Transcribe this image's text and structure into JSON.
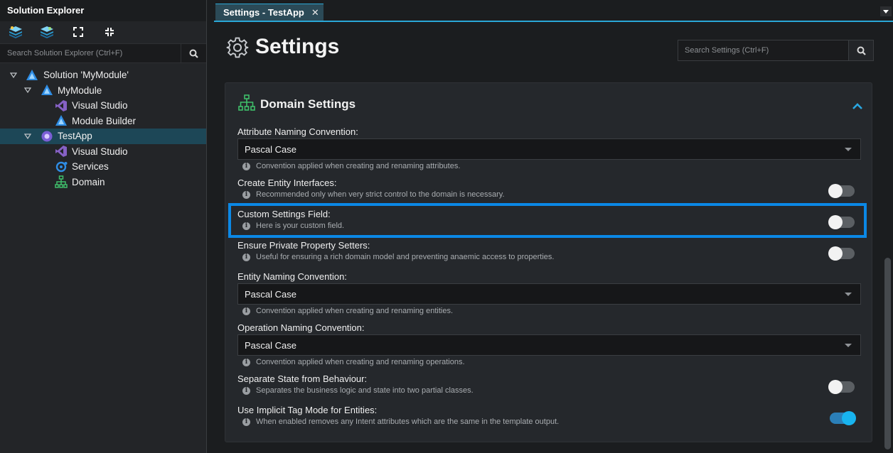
{
  "sidebar": {
    "title": "Solution Explorer",
    "toolbar": [
      {
        "icon": "layers-stack-icon"
      },
      {
        "icon": "layers-stack-icon"
      },
      {
        "icon": "expand-icon"
      },
      {
        "icon": "collapse-icon"
      }
    ],
    "search_placeholder": "Search Solution Explorer (Ctrl+F)",
    "tree": [
      {
        "label": "Solution 'MyModule'",
        "icon": "solution-icon"
      },
      {
        "label": "MyModule",
        "icon": "module-icon"
      },
      {
        "label": "Visual Studio",
        "icon": "visual-studio-icon"
      },
      {
        "label": "Module Builder",
        "icon": "module-builder-icon"
      },
      {
        "label": "TestApp",
        "icon": "app-icon",
        "selected": true
      },
      {
        "label": "Visual Studio",
        "icon": "visual-studio-icon"
      },
      {
        "label": "Services",
        "icon": "services-icon"
      },
      {
        "label": "Domain",
        "icon": "domain-icon"
      }
    ]
  },
  "tab": {
    "label": "Settings - TestApp",
    "close": "✕"
  },
  "main": {
    "title": "Settings",
    "search_placeholder": "Search Settings (Ctrl+F)",
    "section": {
      "title": "Domain Settings",
      "fields": [
        {
          "label": "Attribute Naming Convention:",
          "type": "select",
          "value": "Pascal Case",
          "hint": "Convention applied when creating and renaming attributes."
        },
        {
          "label": "Create Entity Interfaces:",
          "type": "toggle",
          "on": false,
          "hint": "Recommended only when very strict control to the domain is necessary."
        },
        {
          "label": "Custom Settings Field:",
          "type": "toggle",
          "on": false,
          "hint": "Here is your custom field."
        },
        {
          "label": "Ensure Private Property Setters:",
          "type": "toggle",
          "on": false,
          "hint": "Useful for ensuring a rich domain model and preventing anaemic access to properties."
        },
        {
          "label": "Entity Naming Convention:",
          "type": "select",
          "value": "Pascal Case",
          "hint": "Convention applied when creating and renaming entities."
        },
        {
          "label": "Operation Naming Convention:",
          "type": "select",
          "value": "Pascal Case",
          "hint": "Convention applied when creating and renaming operations."
        },
        {
          "label": "Separate State from Behaviour:",
          "type": "toggle",
          "on": false,
          "hint": "Separates the business logic and state into two partial classes."
        },
        {
          "label": "Use Implicit Tag Mode for Entities:",
          "type": "toggle",
          "on": true,
          "hint": "When enabled removes any Intent attributes which are the same in the template output."
        }
      ]
    }
  },
  "colors": {
    "accent": "#2aa7d6",
    "highlight": "#0b88e6",
    "toggle_on": "#18b4ef"
  }
}
